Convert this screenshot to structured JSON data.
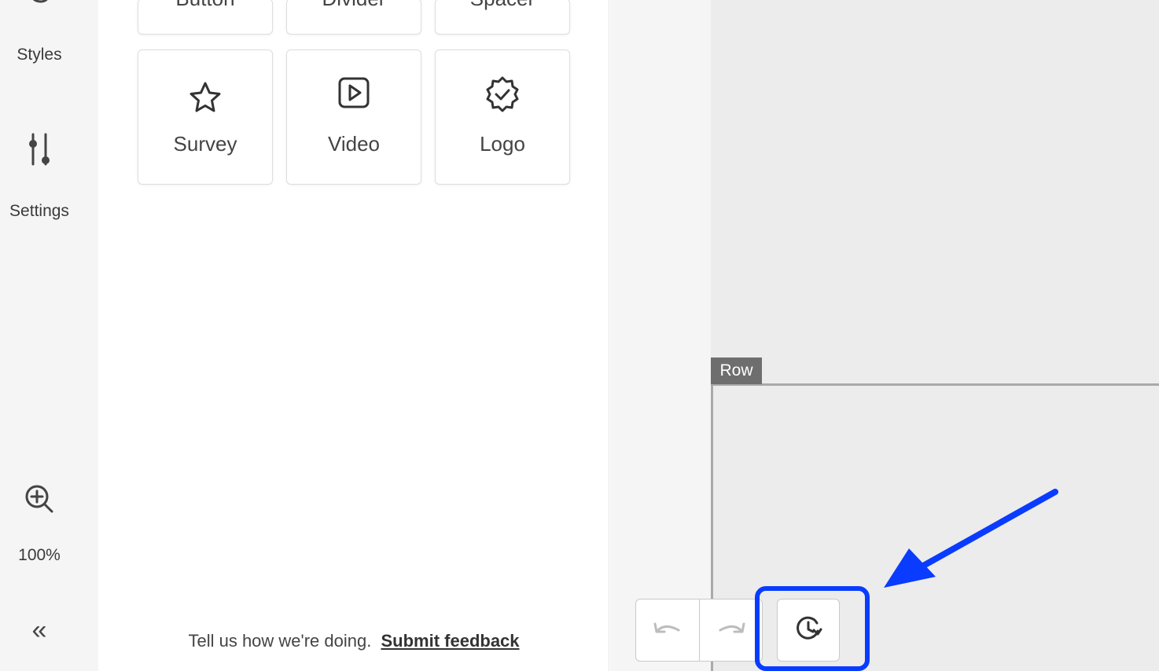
{
  "rail": {
    "styles_label": "Styles",
    "settings_label": "Settings",
    "zoom_label": "100%",
    "collapse_glyph": "«",
    "icons": {
      "styles": "palette-icon",
      "settings": "sliders-icon",
      "zoom": "zoom-in-icon",
      "collapse": "double-chevron-left-icon"
    }
  },
  "elements": {
    "top_row_partial": [
      "Button",
      "Divider",
      "Spacer"
    ],
    "tiles": [
      {
        "label": "Survey",
        "icon": "star-icon"
      },
      {
        "label": "Video",
        "icon": "video-play-icon"
      },
      {
        "label": "Logo",
        "icon": "verified-badge-icon"
      }
    ]
  },
  "feedback": {
    "prompt": "Tell us how we're doing.",
    "link": "Submit feedback"
  },
  "canvas": {
    "row_tag": "Row"
  },
  "toolbar": {
    "icons": [
      "undo-icon",
      "redo-icon",
      "history-icon"
    ]
  },
  "colors": {
    "highlight": "#0a3cff",
    "canvas_bg": "#ececec",
    "rail_bg": "#f5f5f5",
    "row_tag_bg": "#6e6e6e"
  }
}
